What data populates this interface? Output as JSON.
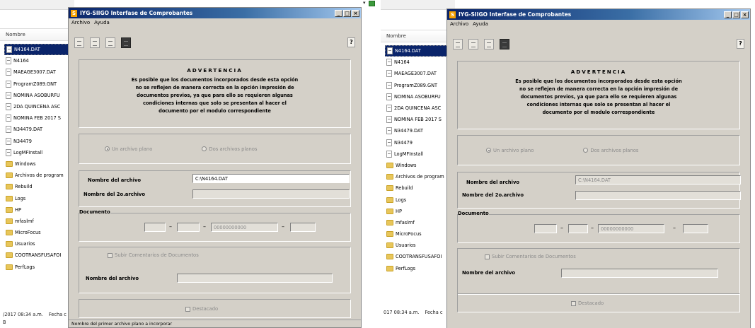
{
  "explorer": {
    "column_header": "Nombre",
    "items": [
      {
        "name": "N4164.DAT",
        "icon": "dat-file-icon",
        "type": "doc",
        "selected": true
      },
      {
        "name": "N4164",
        "icon": "document-icon",
        "type": "doc"
      },
      {
        "name": "MAEAGE3007.DAT",
        "icon": "dat-file-icon",
        "type": "doc"
      },
      {
        "name": "ProgramZ089.GNT",
        "icon": "dat-file-icon",
        "type": "doc"
      },
      {
        "name": "NOMINA ASOBURFU",
        "icon": "document-icon",
        "type": "doc"
      },
      {
        "name": "2DA QUINCENA ASC",
        "icon": "document-icon",
        "type": "doc"
      },
      {
        "name": "NOMINA FEB 2017 S",
        "icon": "document-icon",
        "type": "doc"
      },
      {
        "name": "N34479.DAT",
        "icon": "dat-file-icon",
        "type": "doc"
      },
      {
        "name": "N34479",
        "icon": "document-icon",
        "type": "doc"
      },
      {
        "name": "LogMFInstall",
        "icon": "dat-file-icon",
        "type": "doc"
      },
      {
        "name": "Windows",
        "icon": "folder-icon",
        "type": "folder"
      },
      {
        "name": "Archivos de program",
        "icon": "folder-icon",
        "type": "folder"
      },
      {
        "name": "Rebuild",
        "icon": "folder-icon",
        "type": "folder"
      },
      {
        "name": "Logs",
        "icon": "folder-icon",
        "type": "folder"
      },
      {
        "name": "HP",
        "icon": "folder-icon",
        "type": "folder"
      },
      {
        "name": "mfaslmf",
        "icon": "folder-icon",
        "type": "folder"
      },
      {
        "name": "MicroFocus",
        "icon": "folder-icon",
        "type": "folder"
      },
      {
        "name": "Usuarios",
        "icon": "folder-icon",
        "type": "folder"
      },
      {
        "name": "COOTRANSFUSAFOI",
        "icon": "folder-icon",
        "type": "folder"
      },
      {
        "name": "PerfLogs",
        "icon": "folder-icon",
        "type": "folder"
      }
    ],
    "status_left": {
      "date": "/2017 08:34 a.m.",
      "label": "Fecha c",
      "line2": "B"
    },
    "status_right": {
      "date": "017 08:34 a.m.",
      "label": "Fecha c"
    }
  },
  "window": {
    "title": "IYG-SIIGO Interfase de Comprobantes",
    "logo_letter": "S",
    "buttons": {
      "minimize": "_",
      "maximize": "□",
      "close": "×"
    },
    "menu": [
      "Archivo",
      "Ayuda"
    ],
    "help_button": "?",
    "warning": {
      "title": "ADVERTENCIA",
      "lines": [
        "Es posible que los documentos incorporados desde esta opción",
        "no se reflejen de manera correcta en la opción impresión de",
        "documentos previos, ya que para ello se requieren algunas",
        "condiciones internas que solo se presentan al hacer el",
        "documento por el modulo  correspondiente"
      ]
    },
    "radio_one": "Un archivo plano",
    "radio_two": "Dos archivos planos",
    "file_label": "Nombre del archivo",
    "file2_label": "Nombre del 2o.archivo",
    "document_label": "Documento",
    "document_number_placeholder": "00000000000",
    "comments_checkbox": "Subir Comentarios de Documentos",
    "comments_file_label": "Nombre del archivo",
    "destacado_checkbox": "Destacado",
    "status_text": "Nombre del primer archivo plano a incorporar"
  },
  "left_state": {
    "file_value": "C:\\N4164.DAT"
  },
  "right_state": {
    "file_value": "C:\\N4164.DAT"
  },
  "colors": {
    "selection": "#0a246a",
    "dialog_face": "#d4d0c8",
    "titlebar": "#0a246a"
  }
}
